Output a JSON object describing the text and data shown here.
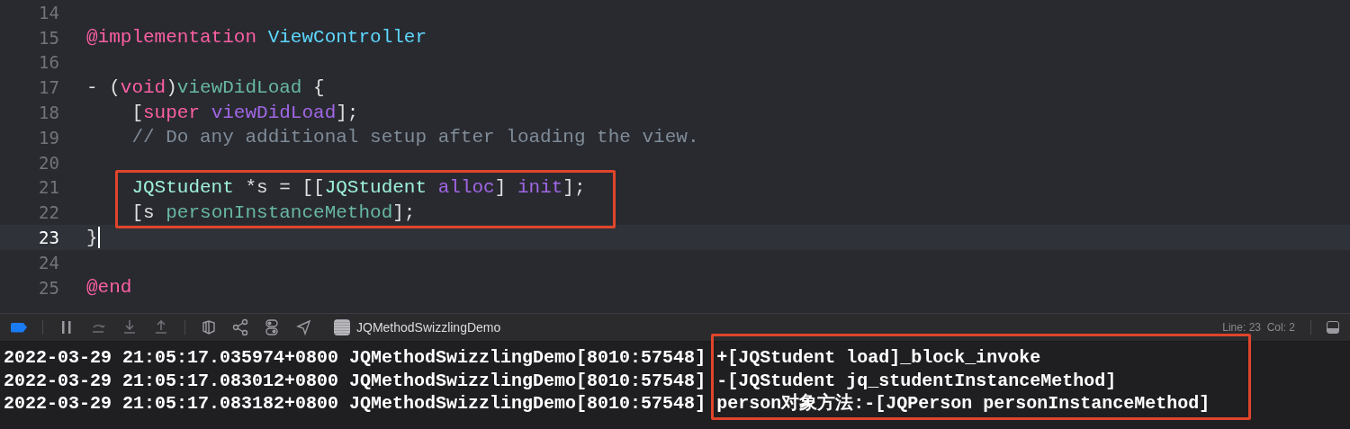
{
  "editor": {
    "lines": [
      {
        "number": "14",
        "current": false
      },
      {
        "number": "15",
        "current": false,
        "tokens": [
          {
            "text": "@implementation",
            "kind": "keyword"
          },
          {
            "text": " ViewController",
            "kind": "type"
          }
        ]
      },
      {
        "number": "16",
        "current": false
      },
      {
        "number": "17",
        "current": false,
        "tokens": [
          {
            "text": "- (",
            "kind": "plain"
          },
          {
            "text": "void",
            "kind": "keyword"
          },
          {
            "text": ")",
            "kind": "plain"
          },
          {
            "text": "viewDidLoad",
            "kind": "declaration"
          },
          {
            "text": " {",
            "kind": "plain"
          }
        ]
      },
      {
        "number": "18",
        "current": false,
        "tokens": [
          {
            "text": "    [",
            "kind": "plain"
          },
          {
            "text": "super",
            "kind": "keyword"
          },
          {
            "text": " viewDidLoad",
            "kind": "method"
          },
          {
            "text": "];",
            "kind": "plain"
          }
        ]
      },
      {
        "number": "19",
        "current": false,
        "tokens": [
          {
            "text": "    // Do any additional setup after loading the view.",
            "kind": "comment"
          }
        ]
      },
      {
        "number": "20",
        "current": false
      },
      {
        "number": "21",
        "current": false,
        "tokens": [
          {
            "text": "    JQStudent",
            "kind": "project"
          },
          {
            "text": " *s = [[",
            "kind": "plain"
          },
          {
            "text": "JQStudent",
            "kind": "project"
          },
          {
            "text": " alloc",
            "kind": "method"
          },
          {
            "text": "] ",
            "kind": "plain"
          },
          {
            "text": "init",
            "kind": "method"
          },
          {
            "text": "];",
            "kind": "plain"
          }
        ]
      },
      {
        "number": "22",
        "current": false,
        "tokens": [
          {
            "text": "    [s ",
            "kind": "plain"
          },
          {
            "text": "personInstanceMethod",
            "kind": "projectmethod"
          },
          {
            "text": "];",
            "kind": "plain"
          }
        ]
      },
      {
        "number": "23",
        "current": true,
        "tokens": [
          {
            "text": "}",
            "kind": "plain"
          }
        ]
      },
      {
        "number": "24",
        "current": false
      },
      {
        "number": "25",
        "current": false,
        "tokens": [
          {
            "text": "@end",
            "kind": "keyword"
          }
        ]
      }
    ]
  },
  "debug_bar": {
    "target": "JQMethodSwizzlingDemo",
    "breakpoints_active": true,
    "position": "Line: 23  Col: 2"
  },
  "console": {
    "lines": [
      "2022-03-29 21:05:17.035974+0800 JQMethodSwizzlingDemo[8010:57548] +[JQStudent load]_block_invoke",
      "2022-03-29 21:05:17.083012+0800 JQMethodSwizzlingDemo[8010:57548] -[JQStudent jq_studentInstanceMethod]",
      "2022-03-29 21:05:17.083182+0800 JQMethodSwizzlingDemo[8010:57548] person对象方法:-[JQPerson personInstanceMethod]"
    ]
  }
}
